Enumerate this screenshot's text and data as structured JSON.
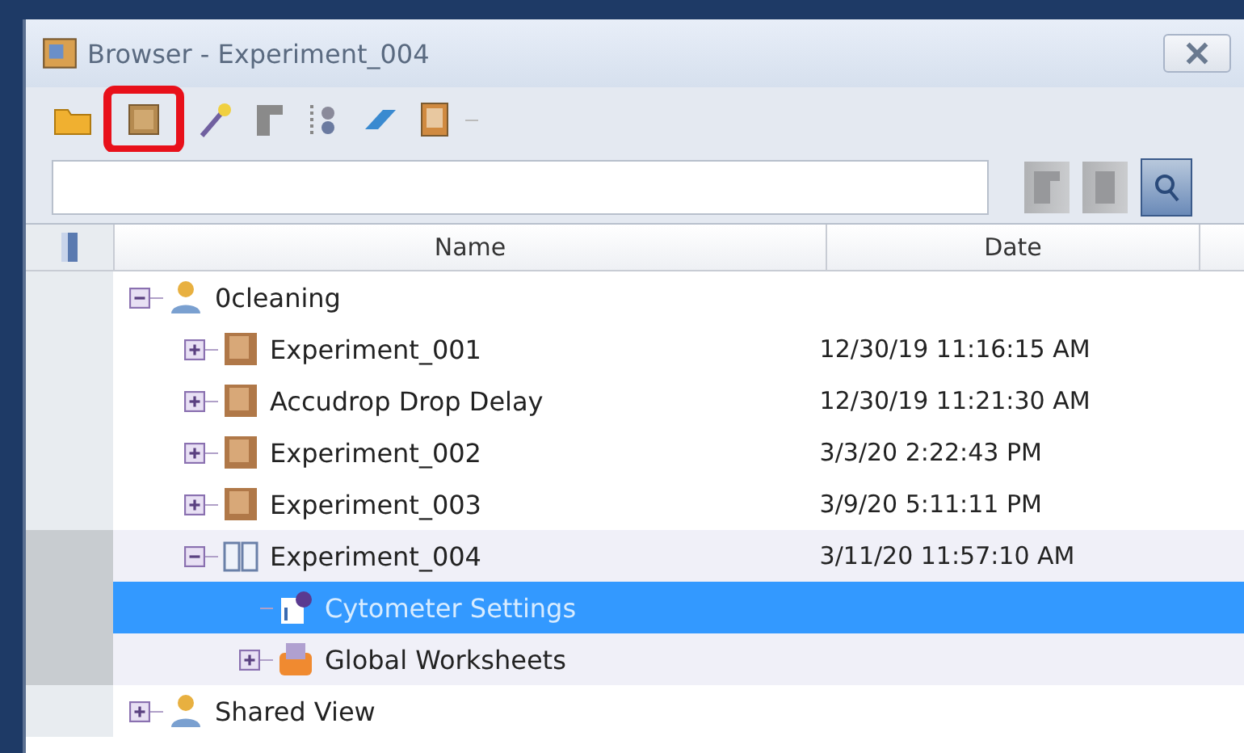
{
  "window": {
    "title": "Browser - Experiment_004"
  },
  "toolbar": [
    {
      "kind": "folder",
      "highlighted": false
    },
    {
      "kind": "experiment",
      "highlighted": true
    },
    {
      "kind": "wand",
      "highlighted": false
    },
    {
      "kind": "panel",
      "highlighted": false
    },
    {
      "kind": "tree",
      "highlighted": false
    },
    {
      "kind": "eraser",
      "highlighted": false
    },
    {
      "kind": "document",
      "highlighted": false
    }
  ],
  "search": {
    "buttons": [
      {
        "kind": "sheet",
        "disabled": true
      },
      {
        "kind": "block",
        "disabled": true
      },
      {
        "kind": "find",
        "disabled": false
      }
    ]
  },
  "table": {
    "columns": [
      "Name",
      "Date"
    ],
    "tree": [
      {
        "kind": "user",
        "name": "0cleaning",
        "expanded": true,
        "selected": false,
        "shaded": false,
        "children": [
          {
            "kind": "experiment",
            "name": "Experiment_001",
            "date": "12/30/19 11:16:15 AM",
            "expanded": false,
            "selected": false,
            "shaded": false
          },
          {
            "kind": "experiment",
            "name": "Accudrop Drop Delay",
            "date": "12/30/19 11:21:30 AM",
            "expanded": false,
            "selected": false,
            "shaded": false
          },
          {
            "kind": "experiment",
            "name": "Experiment_002",
            "date": "3/3/20 2:22:43 PM",
            "expanded": false,
            "selected": false,
            "shaded": false
          },
          {
            "kind": "experiment",
            "name": "Experiment_003",
            "date": "3/9/20 5:11:11 PM",
            "expanded": false,
            "selected": false,
            "shaded": false
          },
          {
            "kind": "book",
            "name": "Experiment_004",
            "date": "3/11/20 11:57:10 AM",
            "expanded": true,
            "selected": false,
            "shaded": true,
            "children": [
              {
                "kind": "settings",
                "name": "Cytometer Settings",
                "selected": true,
                "shaded": false
              },
              {
                "kind": "worksheets",
                "name": "Global Worksheets",
                "expanded": false,
                "selected": false,
                "shaded": true
              }
            ]
          }
        ]
      },
      {
        "kind": "user",
        "name": "Shared View",
        "expanded": false,
        "selected": false,
        "shaded": false
      }
    ]
  }
}
